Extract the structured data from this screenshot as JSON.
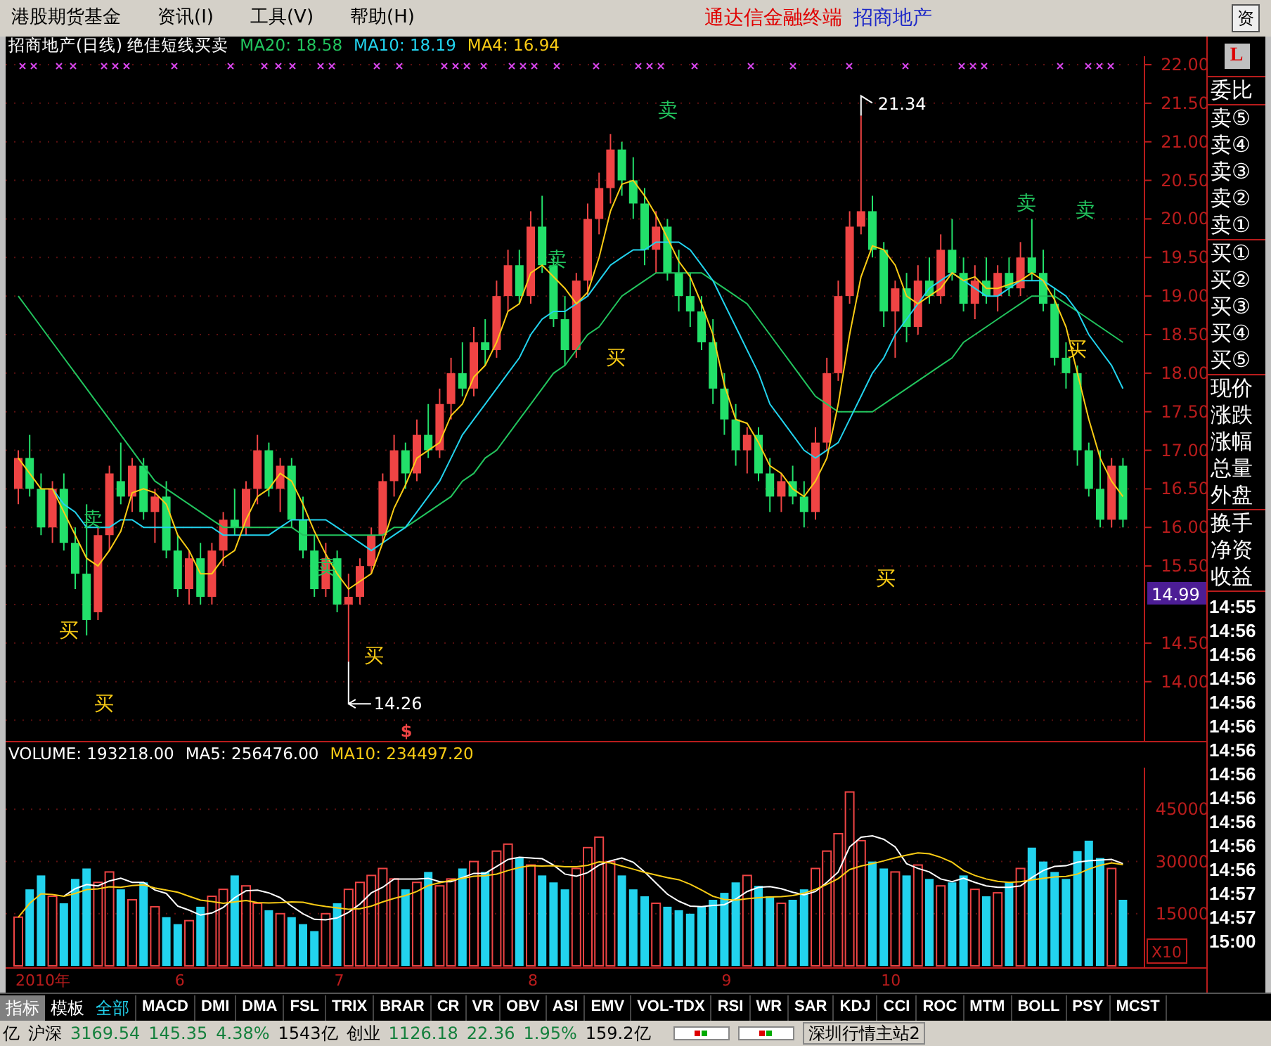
{
  "menu_bar": {
    "items": [
      "港股期货基金",
      "资讯(I)",
      "工具(V)",
      "帮助(H)"
    ],
    "app_title": "通达信金融终端",
    "stock_name": "招商地产",
    "right_button": "资"
  },
  "chart_header": {
    "title": "招商地产(日线) 绝佳短线买卖",
    "indicators": [
      {
        "label": "MA20: 18.58",
        "color": "#22c55e"
      },
      {
        "label": "MA10: 18.19",
        "color": "#22d3ee"
      },
      {
        "label": "MA4: 16.94",
        "color": "#facc15"
      }
    ]
  },
  "price_axis": {
    "current_price": "14.99"
  },
  "price_chart": {
    "chart_data": {
      "type": "candlestick",
      "ylim": [
        13.25,
        22
      ],
      "grid": true,
      "yticks": [
        {
          "value": 22,
          "label": "22.00"
        },
        {
          "value": 21.5,
          "label": "21.50"
        },
        {
          "value": 21,
          "label": "21.00"
        },
        {
          "value": 20.5,
          "label": "20.50"
        },
        {
          "value": 20,
          "label": "20.00"
        },
        {
          "value": 19.5,
          "label": "19.50"
        },
        {
          "value": 19,
          "label": "19.00"
        },
        {
          "value": 18.5,
          "label": "18.50"
        },
        {
          "value": 18,
          "label": "18.00"
        },
        {
          "value": 17.5,
          "label": "17.50"
        },
        {
          "value": 17,
          "label": "17.00"
        },
        {
          "value": 16.5,
          "label": "16.50"
        },
        {
          "value": 16,
          "label": "16.00"
        },
        {
          "value": 15.5,
          "label": "15.50"
        },
        {
          "value": 14.5,
          "label": "14.50"
        },
        {
          "value": 14,
          "label": "14.00"
        }
      ],
      "ohlc": [
        [
          16.5,
          17.0,
          16.3,
          16.9
        ],
        [
          16.9,
          17.2,
          16.4,
          16.5
        ],
        [
          16.5,
          16.7,
          15.9,
          16.0
        ],
        [
          16.0,
          16.6,
          15.8,
          16.5
        ],
        [
          16.5,
          16.7,
          15.7,
          15.8
        ],
        [
          15.8,
          16.0,
          15.2,
          15.4
        ],
        [
          15.4,
          16.3,
          14.6,
          14.8
        ],
        [
          14.9,
          16.0,
          14.8,
          15.9
        ],
        [
          15.9,
          16.8,
          15.7,
          16.7
        ],
        [
          16.6,
          17.1,
          16.3,
          16.4
        ],
        [
          16.4,
          16.9,
          16.2,
          16.8
        ],
        [
          16.8,
          16.9,
          16.1,
          16.2
        ],
        [
          16.2,
          16.5,
          15.8,
          16.4
        ],
        [
          16.4,
          16.6,
          15.6,
          15.7
        ],
        [
          15.7,
          15.9,
          15.1,
          15.2
        ],
        [
          15.2,
          15.7,
          15.0,
          15.6
        ],
        [
          15.6,
          15.8,
          15.0,
          15.1
        ],
        [
          15.1,
          15.8,
          15.0,
          15.7
        ],
        [
          15.7,
          16.2,
          15.5,
          16.1
        ],
        [
          16.1,
          16.5,
          15.9,
          16.0
        ],
        [
          16.0,
          16.6,
          15.9,
          16.5
        ],
        [
          16.5,
          17.2,
          16.3,
          17.0
        ],
        [
          17.0,
          17.1,
          16.4,
          16.5
        ],
        [
          16.5,
          16.9,
          16.2,
          16.8
        ],
        [
          16.8,
          16.9,
          16.0,
          16.1
        ],
        [
          16.1,
          16.4,
          15.6,
          15.7
        ],
        [
          15.7,
          15.9,
          15.1,
          15.2
        ],
        [
          15.2,
          15.8,
          15.1,
          15.6
        ],
        [
          15.6,
          15.7,
          14.9,
          15.0
        ],
        [
          15.0,
          15.4,
          14.26,
          15.1
        ],
        [
          15.1,
          15.6,
          15.0,
          15.5
        ],
        [
          15.5,
          16.0,
          15.4,
          15.9
        ],
        [
          15.9,
          16.7,
          15.8,
          16.6
        ],
        [
          16.6,
          17.2,
          16.4,
          17.0
        ],
        [
          17.0,
          17.1,
          16.5,
          16.7
        ],
        [
          16.7,
          17.4,
          16.6,
          17.2
        ],
        [
          17.2,
          17.6,
          16.9,
          17.0
        ],
        [
          17.0,
          17.8,
          16.9,
          17.6
        ],
        [
          17.6,
          18.2,
          17.4,
          18.0
        ],
        [
          18.0,
          18.4,
          17.7,
          17.8
        ],
        [
          17.8,
          18.6,
          17.7,
          18.4
        ],
        [
          18.4,
          18.7,
          18.1,
          18.3
        ],
        [
          18.3,
          19.2,
          18.2,
          19.0
        ],
        [
          19.0,
          19.6,
          18.8,
          19.4
        ],
        [
          19.4,
          19.6,
          18.9,
          19.0
        ],
        [
          19.0,
          20.1,
          18.9,
          19.9
        ],
        [
          19.9,
          20.3,
          19.3,
          19.4
        ],
        [
          19.4,
          19.5,
          18.6,
          18.7
        ],
        [
          18.7,
          19.0,
          18.1,
          18.3
        ],
        [
          18.3,
          19.3,
          18.2,
          19.2
        ],
        [
          19.2,
          20.2,
          19.0,
          20.0
        ],
        [
          20.0,
          20.6,
          19.8,
          20.4
        ],
        [
          20.4,
          21.1,
          20.2,
          20.9
        ],
        [
          20.9,
          21.0,
          20.3,
          20.5
        ],
        [
          20.5,
          20.8,
          20.0,
          20.2
        ],
        [
          20.2,
          20.4,
          19.4,
          19.6
        ],
        [
          19.6,
          20.1,
          19.3,
          19.9
        ],
        [
          19.9,
          20.0,
          19.2,
          19.3
        ],
        [
          19.3,
          19.6,
          18.8,
          19.0
        ],
        [
          19.0,
          19.3,
          18.6,
          18.8
        ],
        [
          18.8,
          19.0,
          18.3,
          18.4
        ],
        [
          18.4,
          18.7,
          17.6,
          17.8
        ],
        [
          17.8,
          18.0,
          17.2,
          17.4
        ],
        [
          17.4,
          17.6,
          16.8,
          17.0
        ],
        [
          17.0,
          17.3,
          16.7,
          17.2
        ],
        [
          17.2,
          17.3,
          16.6,
          16.7
        ],
        [
          16.7,
          16.9,
          16.2,
          16.4
        ],
        [
          16.4,
          16.7,
          16.2,
          16.6
        ],
        [
          16.6,
          16.8,
          16.3,
          16.4
        ],
        [
          16.4,
          16.6,
          16.0,
          16.2
        ],
        [
          16.2,
          17.3,
          16.1,
          17.1
        ],
        [
          17.1,
          18.2,
          17.0,
          18.0
        ],
        [
          18.0,
          19.2,
          17.9,
          19.0
        ],
        [
          19.0,
          20.1,
          18.9,
          19.9
        ],
        [
          19.9,
          21.34,
          19.8,
          20.1
        ],
        [
          20.1,
          20.3,
          19.5,
          19.6
        ],
        [
          19.6,
          19.7,
          18.6,
          18.8
        ],
        [
          18.8,
          19.2,
          18.2,
          19.1
        ],
        [
          19.1,
          19.3,
          18.4,
          18.6
        ],
        [
          18.6,
          19.4,
          18.5,
          19.2
        ],
        [
          19.2,
          19.5,
          18.9,
          19.0
        ],
        [
          19.0,
          19.8,
          18.9,
          19.6
        ],
        [
          19.6,
          20.0,
          19.2,
          19.3
        ],
        [
          19.3,
          19.5,
          18.8,
          18.9
        ],
        [
          18.9,
          19.4,
          18.7,
          19.2
        ],
        [
          19.2,
          19.5,
          18.9,
          19.0
        ],
        [
          19.0,
          19.4,
          18.8,
          19.3
        ],
        [
          19.3,
          19.5,
          19.0,
          19.1
        ],
        [
          19.1,
          19.7,
          19.0,
          19.5
        ],
        [
          19.5,
          20.0,
          19.2,
          19.3
        ],
        [
          19.3,
          19.6,
          18.8,
          18.9
        ],
        [
          18.9,
          19.1,
          18.1,
          18.2
        ],
        [
          18.2,
          18.4,
          17.8,
          18.0
        ],
        [
          18.0,
          18.1,
          16.8,
          17.0
        ],
        [
          17.0,
          17.1,
          16.4,
          16.5
        ],
        [
          16.5,
          17.0,
          16.0,
          16.1
        ],
        [
          16.1,
          16.9,
          16.0,
          16.8
        ],
        [
          16.8,
          16.9,
          16.0,
          16.1
        ]
      ],
      "series": [
        {
          "type": "line",
          "color": "#22c55e",
          "values": [
            19.0,
            18.8,
            18.6,
            18.4,
            18.2,
            18.0,
            17.8,
            17.6,
            17.4,
            17.2,
            17.0,
            16.8,
            16.6,
            16.5,
            16.4,
            16.3,
            16.2,
            16.1,
            16.0,
            16.0,
            16.0,
            16.0,
            16.0,
            16.0,
            16.0,
            15.9,
            15.9,
            15.9,
            15.9,
            15.9,
            15.9,
            15.9,
            15.9,
            16.0,
            16.0,
            16.1,
            16.2,
            16.3,
            16.4,
            16.6,
            16.7,
            16.9,
            17.0,
            17.2,
            17.4,
            17.6,
            17.8,
            18.0,
            18.1,
            18.3,
            18.5,
            18.6,
            18.8,
            19.0,
            19.1,
            19.2,
            19.3,
            19.3,
            19.3,
            19.3,
            19.3,
            19.2,
            19.1,
            19.0,
            18.9,
            18.7,
            18.5,
            18.3,
            18.1,
            17.9,
            17.7,
            17.6,
            17.5,
            17.5,
            17.5,
            17.5,
            17.6,
            17.7,
            17.8,
            17.9,
            18.0,
            18.1,
            18.2,
            18.4,
            18.5,
            18.6,
            18.7,
            18.8,
            18.9,
            19.0,
            19.0,
            19.0,
            18.9,
            18.8,
            18.7,
            18.6,
            18.5,
            18.4
          ]
        },
        {
          "type": "line",
          "color": "#22d3ee",
          "values": [
            null,
            null,
            null,
            16.5,
            16.3,
            16.2,
            16.0,
            16.0,
            16.0,
            16.1,
            16.1,
            16.0,
            16.0,
            16.0,
            16.0,
            16.0,
            16.0,
            16.0,
            15.9,
            15.9,
            15.9,
            15.9,
            15.9,
            16.0,
            16.1,
            16.1,
            16.1,
            16.1,
            16.0,
            15.9,
            15.8,
            15.7,
            15.8,
            15.9,
            16.0,
            16.2,
            16.4,
            16.6,
            16.9,
            17.2,
            17.4,
            17.6,
            17.8,
            18.0,
            18.2,
            18.5,
            18.7,
            18.8,
            18.8,
            18.9,
            19.0,
            19.2,
            19.4,
            19.5,
            19.6,
            19.6,
            19.7,
            19.7,
            19.7,
            19.6,
            19.4,
            19.2,
            18.9,
            18.6,
            18.3,
            18.0,
            17.6,
            17.4,
            17.2,
            17.0,
            16.9,
            17.0,
            17.1,
            17.4,
            17.7,
            18.0,
            18.2,
            18.5,
            18.7,
            18.9,
            19.1,
            19.2,
            19.3,
            19.2,
            19.1,
            19.0,
            19.0,
            19.1,
            19.2,
            19.2,
            19.2,
            19.1,
            19.0,
            18.8,
            18.5,
            18.3,
            18.1,
            17.8
          ]
        },
        {
          "type": "line",
          "color": "#facc15",
          "values": [
            16.9,
            16.7,
            16.5,
            16.5,
            16.2,
            15.9,
            15.6,
            15.5,
            15.7,
            15.95,
            16.45,
            16.5,
            16.45,
            16.3,
            15.9,
            15.7,
            15.4,
            15.4,
            15.6,
            15.7,
            16.1,
            16.4,
            16.5,
            16.7,
            16.6,
            16.3,
            15.95,
            15.65,
            15.4,
            15.2,
            15.3,
            15.4,
            15.8,
            16.25,
            16.55,
            16.9,
            17.0,
            17.1,
            17.45,
            17.6,
            17.95,
            18.1,
            18.4,
            18.8,
            18.9,
            19.3,
            19.4,
            19.25,
            19.1,
            18.9,
            19.05,
            19.5,
            20.1,
            20.45,
            20.5,
            20.3,
            20.05,
            19.75,
            19.45,
            19.25,
            18.9,
            18.5,
            17.85,
            17.4,
            17.35,
            17.1,
            16.8,
            16.7,
            16.5,
            16.4,
            16.6,
            16.9,
            17.6,
            18.5,
            19.25,
            19.65,
            19.6,
            19.4,
            19.0,
            18.9,
            19.0,
            19.1,
            19.3,
            19.2,
            19.25,
            19.1,
            19.1,
            19.15,
            19.2,
            19.3,
            19.2,
            18.95,
            18.6,
            18.0,
            17.4,
            16.9,
            16.6,
            16.4
          ]
        }
      ]
    }
  },
  "signals": [
    {
      "kind": "buy",
      "text": "买"
    },
    {
      "kind": "sell",
      "text": "卖"
    },
    {
      "kind": "buy",
      "text": "买"
    },
    {
      "kind": "sell",
      "text": "卖"
    },
    {
      "kind": "buy",
      "text": "买"
    },
    {
      "kind": "sell",
      "text": "卖"
    },
    {
      "kind": "buy",
      "text": "买"
    },
    {
      "kind": "sell",
      "text": "卖"
    },
    {
      "kind": "buy",
      "text": "买"
    },
    {
      "kind": "sell",
      "text": "卖"
    },
    {
      "kind": "buy",
      "text": "买"
    },
    {
      "kind": "sell",
      "text": "卖"
    }
  ],
  "annotations": [
    {
      "kind": "high",
      "text": "21.34"
    },
    {
      "kind": "low",
      "text": "14.26"
    },
    {
      "kind": "mark",
      "text": "$"
    }
  ],
  "volume_header": [
    {
      "label": "VOLUME: 193218.00",
      "color": "#ffffff"
    },
    {
      "label": "MA5: 256476.00",
      "color": "#ffffff"
    },
    {
      "label": "MA10: 234497.20",
      "color": "#facc15"
    }
  ],
  "volume_axis": {
    "scale": "X10"
  },
  "volume_chart": {
    "chart_data": {
      "type": "bar",
      "ylim": [
        0,
        57000
      ],
      "grid": true,
      "yticks": [
        {
          "value": 45000,
          "label": "45000"
        },
        {
          "value": 30000,
          "label": "30000"
        },
        {
          "value": 15000,
          "label": "15000"
        }
      ],
      "colors": [
        "#ef4444",
        "#22d3ee",
        "#22d3ee",
        "#ef4444",
        "#22d3ee",
        "#22d3ee",
        "#22d3ee",
        "#ef4444",
        "#ef4444",
        "#22d3ee",
        "#ef4444",
        "#22d3ee",
        "#ef4444",
        "#22d3ee",
        "#22d3ee",
        "#ef4444",
        "#22d3ee",
        "#ef4444",
        "#ef4444",
        "#22d3ee",
        "#ef4444",
        "#ef4444",
        "#22d3ee",
        "#ef4444",
        "#22d3ee",
        "#22d3ee",
        "#22d3ee",
        "#ef4444",
        "#22d3ee",
        "#ef4444",
        "#ef4444",
        "#ef4444",
        "#ef4444",
        "#ef4444",
        "#22d3ee",
        "#ef4444",
        "#22d3ee",
        "#ef4444",
        "#ef4444",
        "#22d3ee",
        "#ef4444",
        "#22d3ee",
        "#ef4444",
        "#ef4444",
        "#22d3ee",
        "#ef4444",
        "#22d3ee",
        "#22d3ee",
        "#22d3ee",
        "#ef4444",
        "#ef4444",
        "#ef4444",
        "#ef4444",
        "#22d3ee",
        "#22d3ee",
        "#22d3ee",
        "#ef4444",
        "#22d3ee",
        "#22d3ee",
        "#22d3ee",
        "#22d3ee",
        "#22d3ee",
        "#22d3ee",
        "#22d3ee",
        "#ef4444",
        "#22d3ee",
        "#22d3ee",
        "#ef4444",
        "#22d3ee",
        "#22d3ee",
        "#ef4444",
        "#ef4444",
        "#ef4444",
        "#ef4444",
        "#ef4444",
        "#22d3ee",
        "#22d3ee",
        "#ef4444",
        "#22d3ee",
        "#ef4444",
        "#22d3ee",
        "#ef4444",
        "#22d3ee",
        "#22d3ee",
        "#ef4444",
        "#22d3ee",
        "#ef4444",
        "#22d3ee",
        "#ef4444",
        "#22d3ee",
        "#22d3ee",
        "#22d3ee",
        "#22d3ee",
        "#22d3ee",
        "#22d3ee",
        "#22d3ee",
        "#ef4444",
        "#22d3ee"
      ],
      "values": [
        14000,
        22000,
        26000,
        20000,
        18000,
        25000,
        28000,
        24000,
        27000,
        22000,
        19000,
        24000,
        17000,
        14000,
        12000,
        13000,
        17000,
        20000,
        22000,
        26000,
        23000,
        18000,
        16000,
        15000,
        14000,
        12000,
        10000,
        15000,
        18000,
        22000,
        24000,
        26000,
        28000,
        25000,
        22000,
        24000,
        27000,
        23000,
        25000,
        28000,
        30000,
        27000,
        33000,
        35000,
        31000,
        29000,
        26000,
        24000,
        22000,
        28000,
        34000,
        37000,
        30000,
        26000,
        22000,
        20000,
        18000,
        17000,
        16000,
        15000,
        17000,
        19000,
        21000,
        24000,
        26000,
        23000,
        20000,
        18000,
        19000,
        22000,
        28000,
        33000,
        38000,
        50000,
        36000,
        30000,
        28000,
        27000,
        26000,
        29000,
        25000,
        23000,
        24000,
        26000,
        22000,
        20000,
        21000,
        24000,
        28000,
        34000,
        30000,
        27000,
        25000,
        33000,
        36000,
        31000,
        28000,
        19000
      ],
      "series": [
        {
          "type": "line",
          "color": "#ffffff",
          "values": [
            null,
            null,
            null,
            null,
            20000,
            22200,
            23400,
            23000,
            24400,
            25200,
            24000,
            24000,
            21800,
            20800,
            17200,
            16000,
            14600,
            15200,
            16800,
            19600,
            21600,
            21800,
            21000,
            19600,
            17200,
            15000,
            13400,
            13200,
            13800,
            15400,
            17800,
            21000,
            22600,
            25000,
            25000,
            25000,
            25200,
            24200,
            24200,
            25400,
            26600,
            26600,
            28600,
            30600,
            31200,
            31000,
            30800,
            29000,
            26400,
            25800,
            26800,
            29000,
            30200,
            31000,
            29800,
            27000,
            23800,
            20600,
            18600,
            17200,
            17000,
            17400,
            17600,
            19200,
            21400,
            22600,
            22800,
            22200,
            21200,
            20400,
            21400,
            24000,
            27000,
            34200,
            37000,
            37400,
            36400,
            34200,
            29400,
            28000,
            27000,
            25000,
            24200,
            25200,
            24000,
            23000,
            22600,
            22600,
            23000,
            25400,
            27400,
            28600,
            28800,
            29800,
            30200,
            30400,
            30600,
            29400
          ]
        },
        {
          "type": "line",
          "color": "#facc15",
          "values": [
            14000,
            18000,
            20700,
            20500,
            20000,
            20800,
            21900,
            22100,
            22700,
            22600,
            23100,
            23300,
            22400,
            21800,
            21200,
            20000,
            18900,
            18500,
            18000,
            18400,
            18800,
            18200,
            18100,
            18200,
            18400,
            18300,
            17600,
            17100,
            16700,
            16300,
            16400,
            17200,
            18400,
            19400,
            20200,
            21400,
            23100,
            23900,
            24600,
            25200,
            25800,
            25900,
            26400,
            27400,
            28300,
            28800,
            28700,
            28800,
            28500,
            28500,
            28900,
            29900,
            29600,
            28700,
            27800,
            26900,
            26100,
            25400,
            24800,
            23500,
            21800,
            20000,
            19100,
            18900,
            19300,
            19600,
            19800,
            19900,
            20200,
            20900,
            22000,
            23400,
            25100,
            27700,
            28700,
            29400,
            30200,
            31100,
            31800,
            32500,
            32200,
            31200,
            29800,
            27400,
            26000,
            25000,
            24300,
            24000,
            24200,
            24700,
            25200,
            25600,
            25700,
            26400,
            27800,
            28900,
            29600,
            29100
          ]
        }
      ]
    }
  },
  "date_axis": [
    "2010年",
    "6",
    "7",
    "8",
    "9",
    "10"
  ],
  "quote_panel": {
    "icon": "L",
    "groups": [
      [
        "委比"
      ],
      [
        "卖⑤",
        "卖④",
        "卖③",
        "卖②",
        "卖①"
      ],
      [
        "买①",
        "买②",
        "买③",
        "买④",
        "买⑤"
      ],
      [
        "现价",
        "涨跌",
        "涨幅",
        "总量",
        "外盘"
      ],
      [
        "换手",
        "净资",
        "收益"
      ]
    ],
    "times": [
      "14:55",
      "14:56",
      "14:56",
      "14:56",
      "14:56",
      "14:56",
      "14:56",
      "14:56",
      "14:56",
      "14:56",
      "14:56",
      "14:56",
      "14:57",
      "14:57",
      "15:00"
    ]
  },
  "tab_bar": {
    "modes": [
      {
        "label": "指标",
        "selected": true
      },
      {
        "label": "模板",
        "selected": false
      }
    ],
    "indicators": [
      {
        "label": "全部",
        "selected": true
      },
      {
        "label": "MACD",
        "selected": false
      },
      {
        "label": "DMI",
        "selected": false
      },
      {
        "label": "DMA",
        "selected": false
      },
      {
        "label": "FSL",
        "selected": false
      },
      {
        "label": "TRIX",
        "selected": false
      },
      {
        "label": "BRAR",
        "selected": false
      },
      {
        "label": "CR",
        "selected": false
      },
      {
        "label": "VR",
        "selected": false
      },
      {
        "label": "OBV",
        "selected": false
      },
      {
        "label": "ASI",
        "selected": false
      },
      {
        "label": "EMV",
        "selected": false
      },
      {
        "label": "VOL-TDX",
        "selected": false
      },
      {
        "label": "RSI",
        "selected": false
      },
      {
        "label": "WR",
        "selected": false
      },
      {
        "label": "SAR",
        "selected": false
      },
      {
        "label": "KDJ",
        "selected": false
      },
      {
        "label": "CCI",
        "selected": false
      },
      {
        "label": "ROC",
        "selected": false
      },
      {
        "label": "MTM",
        "selected": false
      },
      {
        "label": "BOLL",
        "selected": false
      },
      {
        "label": "PSY",
        "selected": false
      },
      {
        "label": "MCST",
        "selected": false
      }
    ]
  },
  "status_bar": {
    "items": [
      {
        "text": "亿",
        "color": "#000000"
      },
      {
        "text": "沪深",
        "color": "#000000"
      },
      {
        "text": "3169.54",
        "color": "#15803d"
      },
      {
        "text": "145.35",
        "color": "#15803d"
      },
      {
        "text": "4.38%",
        "color": "#15803d"
      },
      {
        "text": "1543亿",
        "color": "#000000"
      },
      {
        "text": "创业",
        "color": "#000000"
      },
      {
        "text": "1126.18",
        "color": "#15803d"
      },
      {
        "text": "22.36",
        "color": "#15803d"
      },
      {
        "text": "1.95%",
        "color": "#15803d"
      },
      {
        "text": "159.2亿",
        "color": "#000000"
      }
    ],
    "server": "深圳行情主站2"
  }
}
